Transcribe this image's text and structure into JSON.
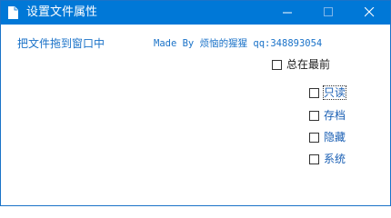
{
  "window": {
    "title": "设置文件属性",
    "icon": "document-icon",
    "titlebar_color": "#0078d7"
  },
  "main": {
    "drag_hint": "把文件拖到窗口中",
    "credits": "Made By 烦恼的猩猩 qq:348893054",
    "text_color": "#1a72c8"
  },
  "options": {
    "always_on_top": {
      "label": "总在最前",
      "checked": false
    },
    "readonly": {
      "label": "只读",
      "checked": false
    },
    "archive": {
      "label": "存档",
      "checked": false
    },
    "hidden": {
      "label": "隐藏",
      "checked": false
    },
    "system": {
      "label": "系统",
      "checked": false
    }
  }
}
